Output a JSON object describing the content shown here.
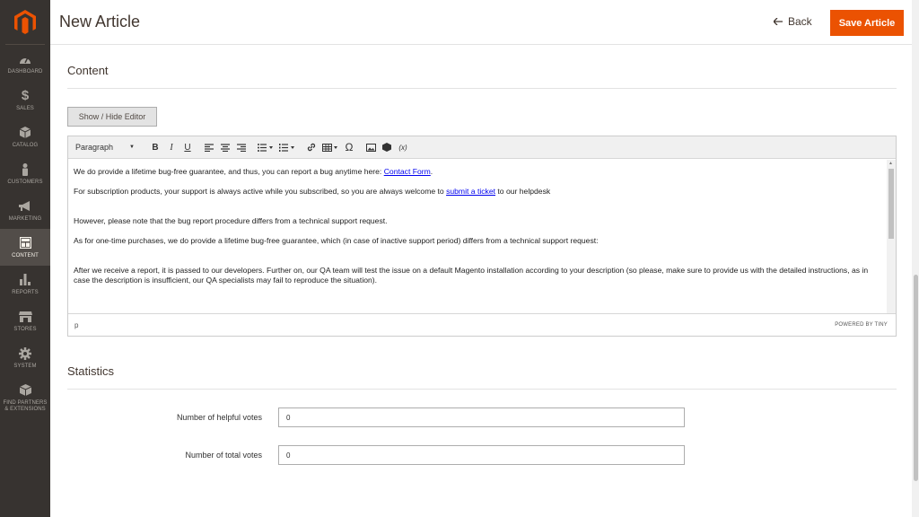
{
  "sidebar": {
    "items": [
      {
        "label": "DASHBOARD",
        "icon": "dashboard-icon"
      },
      {
        "label": "SALES",
        "icon": "dollar-icon"
      },
      {
        "label": "CATALOG",
        "icon": "cube-icon"
      },
      {
        "label": "CUSTOMERS",
        "icon": "person-icon"
      },
      {
        "label": "MARKETING",
        "icon": "megaphone-icon"
      },
      {
        "label": "CONTENT",
        "icon": "layout-icon"
      },
      {
        "label": "REPORTS",
        "icon": "bar-chart-icon"
      },
      {
        "label": "STORES",
        "icon": "store-icon"
      },
      {
        "label": "SYSTEM",
        "icon": "gear-icon"
      },
      {
        "label": "FIND PARTNERS & EXTENSIONS",
        "icon": "box-icon"
      }
    ],
    "active": "CONTENT",
    "colors": {
      "bg": "#373330",
      "active_bg": "#524d49",
      "logo": "#eb5202"
    }
  },
  "header": {
    "title": "New Article",
    "back_label": "Back",
    "save_label": "Save Article",
    "accent": "#eb5202"
  },
  "content_section": {
    "title": "Content",
    "toggle_label": "Show / Hide Editor"
  },
  "editor": {
    "format_select": "Paragraph",
    "toolbar": [
      "bold",
      "italic",
      "underline",
      "align-left",
      "align-center",
      "align-right",
      "bullet-list",
      "numbered-list",
      "link",
      "table",
      "special-char",
      "image",
      "widget",
      "variable"
    ],
    "toolbar_glyphs": {
      "bold": "B",
      "italic": "I",
      "underline": "U",
      "special_char": "Ω",
      "variable": "(x)"
    },
    "paragraphs": {
      "p1_text": "We do provide a lifetime bug-free guarantee, and thus, you can report a bug anytime here: ",
      "p1_link": "Contact Form",
      "p1_end": ".",
      "p2_text": "For subscription products, your support is always active while you subscribed, so you are always welcome to ",
      "p2_link": "submit a ticket",
      "p2_end": " to our helpdesk",
      "p3": "However, please note that the bug report procedure differs from a technical support request.",
      "p4": "As for one-time purchases, we do provide a lifetime bug-free guarantee, which (in case of inactive support period) differs from a technical support request:",
      "p5": "After we receive a report, it is passed to our developers. Further on, our QA team will test the issue on a default Magento installation according to your description (so please, make sure to provide us with the detailed instructions, as in case the description is insufficient, our QA specialists may fail to reproduce the situation)."
    },
    "status_path": "p",
    "powered_by": "POWERED BY TINY"
  },
  "statistics": {
    "title": "Statistics",
    "fields": [
      {
        "label": "Number of helpful votes",
        "value": "0"
      },
      {
        "label": "Number of total votes",
        "value": "0"
      }
    ]
  }
}
